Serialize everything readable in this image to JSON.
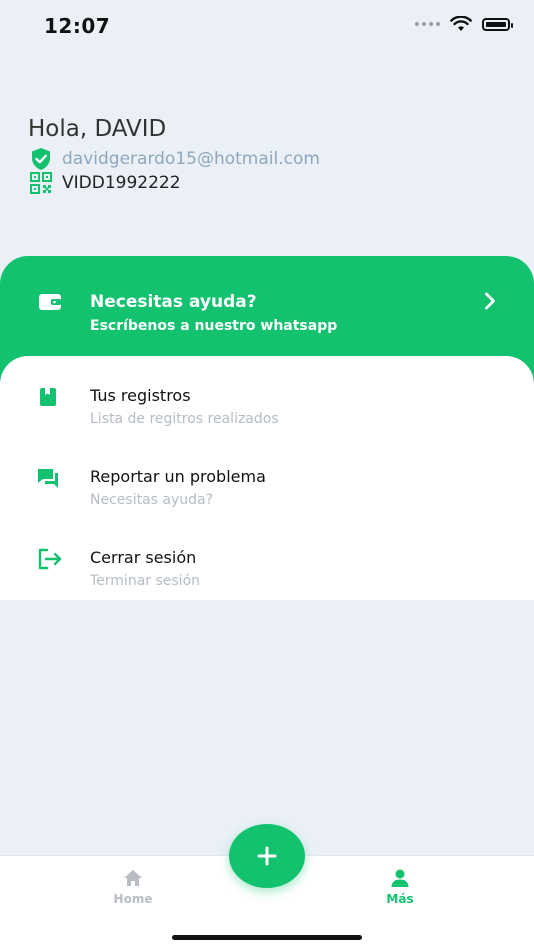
{
  "status_bar": {
    "time": "12:07"
  },
  "profile": {
    "greeting": "Hola, DAVID",
    "email": "davidgerardo15@hotmail.com",
    "user_id": "VIDD1992222"
  },
  "help_card": {
    "title": "Necesitas ayuda?",
    "subtitle": "Escríbenos a nuestro whatsapp"
  },
  "menu": {
    "items": [
      {
        "title": "Tus registros",
        "subtitle": "Lista de regitros realizados",
        "icon": "book-icon"
      },
      {
        "title": "Reportar un problema",
        "subtitle": "Necesitas ayuda?",
        "icon": "chat-icon"
      },
      {
        "title": "Cerrar sesión",
        "subtitle": "Terminar sesión",
        "icon": "logout-icon"
      }
    ]
  },
  "bottom_nav": {
    "home_label": "Home",
    "mas_label": "Más",
    "active": "Más"
  },
  "colors": {
    "accent": "#12C26F",
    "background": "#EAF0F6",
    "email_text": "#8FA7BD",
    "subtitle_text": "#B5BCC4"
  }
}
